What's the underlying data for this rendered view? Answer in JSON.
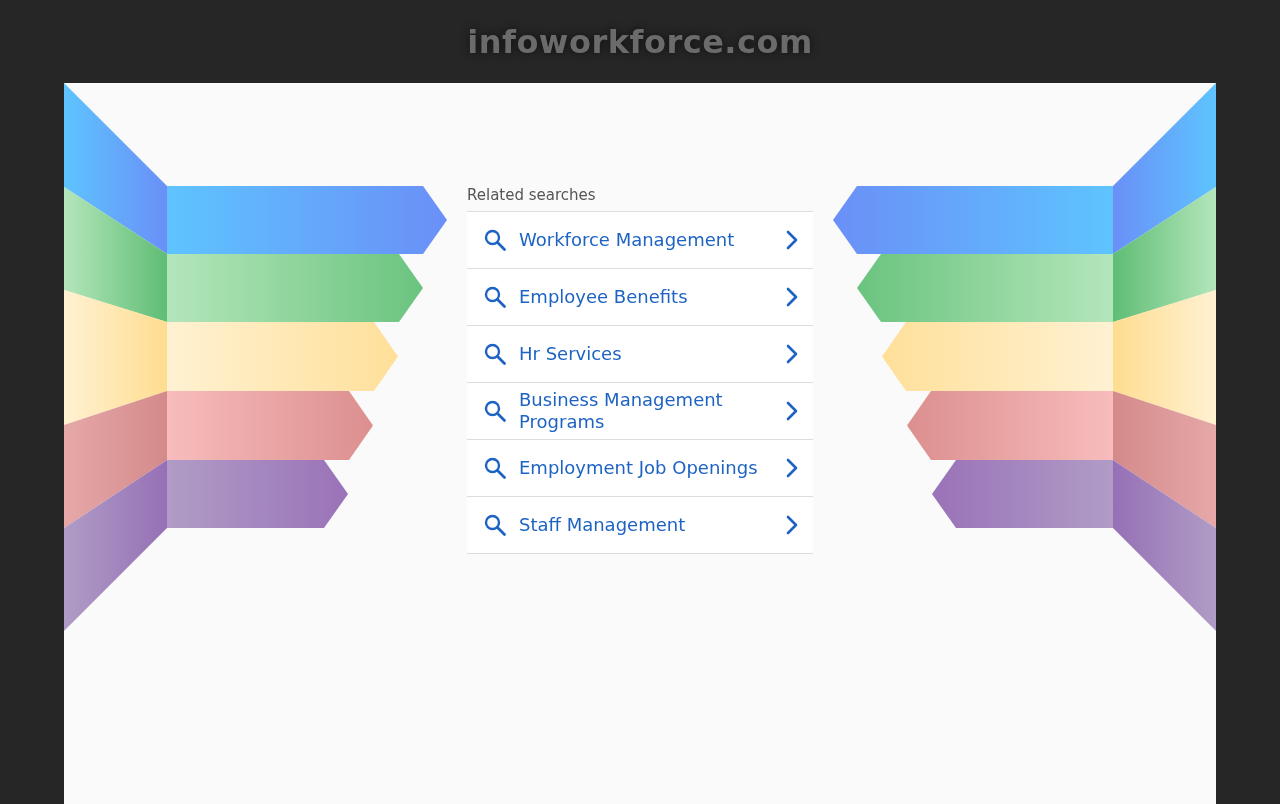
{
  "site_title": "infoworkforce.com",
  "related": {
    "heading": "Related searches",
    "items": [
      {
        "text": "Workforce Management"
      },
      {
        "text": "Employee Benefits"
      },
      {
        "text": "Hr Services"
      },
      {
        "text": "Business Management Programs"
      },
      {
        "text": "Employment Job Openings"
      },
      {
        "text": "Staff Management"
      }
    ]
  }
}
